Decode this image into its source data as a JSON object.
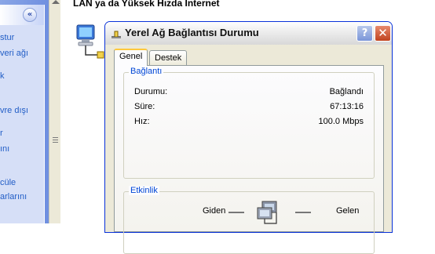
{
  "taskpane": {
    "lines": [
      "stur",
      "veri ağı",
      "k",
      "vre dışı",
      "r",
      "ını",
      "cüle",
      "arlarını"
    ]
  },
  "background": {
    "header": "LAN ya da Yüksek Hızda Internet"
  },
  "dialog": {
    "title": "Yerel Ağ Bağlantısı Durumu",
    "help_label": "?",
    "close_label": "✕",
    "tabs": [
      {
        "label": "Genel"
      },
      {
        "label": "Destek"
      }
    ],
    "connection": {
      "legend": "Bağlantı",
      "rows": [
        {
          "label": "Durumu:",
          "value": "Bağlandı"
        },
        {
          "label": "Süre:",
          "value": "67:13:16"
        },
        {
          "label": "Hız:",
          "value": "100.0 Mbps"
        }
      ]
    },
    "activity": {
      "legend": "Etkinlik",
      "sent_label": "Giden",
      "received_label": "Gelen"
    }
  },
  "colors": {
    "legend_blue": "#0046d5",
    "title_border": "#0831d9",
    "tab_highlight": "#ffc83c"
  },
  "icons": [
    "collapse-chevrons-icon",
    "network-connection-icon",
    "network-title-icon",
    "help-icon",
    "close-icon",
    "activity-computers-icon"
  ]
}
